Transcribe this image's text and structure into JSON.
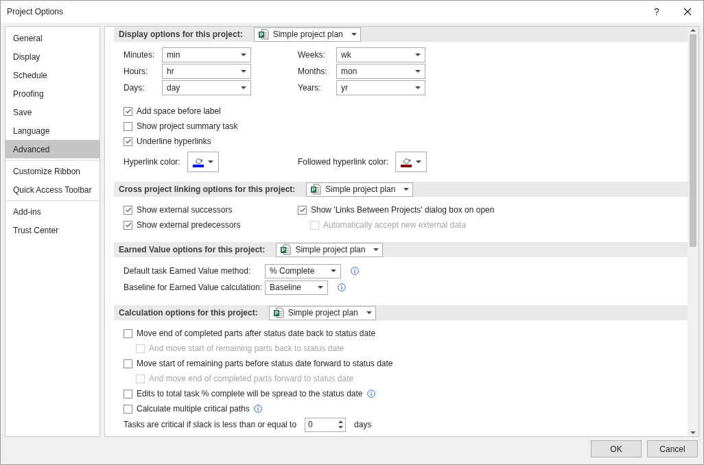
{
  "window": {
    "title": "Project Options",
    "help": "?"
  },
  "sidebar": {
    "groups": [
      [
        {
          "label": "General",
          "selected": false
        },
        {
          "label": "Display",
          "selected": false
        },
        {
          "label": "Schedule",
          "selected": false
        },
        {
          "label": "Proofing",
          "selected": false
        },
        {
          "label": "Save",
          "selected": false
        },
        {
          "label": "Language",
          "selected": false
        },
        {
          "label": "Advanced",
          "selected": true
        }
      ],
      [
        {
          "label": "Customize Ribbon",
          "selected": false
        },
        {
          "label": "Quick Access Toolbar",
          "selected": false
        }
      ],
      [
        {
          "label": "Add-ins",
          "selected": false
        },
        {
          "label": "Trust Center",
          "selected": false
        }
      ]
    ]
  },
  "sections": [
    {
      "title": "Display options for this project:",
      "plan": "Simple project plan",
      "items": [
        {
          "kind": "field_grid",
          "fields": [
            {
              "label": "Minutes:",
              "value": "min"
            },
            {
              "label": "Weeks:",
              "value": "wk"
            },
            {
              "label": "Hours:",
              "value": "hr"
            },
            {
              "label": "Months:",
              "value": "mon"
            },
            {
              "label": "Days:",
              "value": "day"
            },
            {
              "label": "Years:",
              "value": "yr"
            }
          ]
        },
        {
          "kind": "checkbox",
          "label": "Add space before label",
          "checked": true,
          "disabled": false,
          "info": false
        },
        {
          "kind": "checkbox",
          "label": "Show project summary task",
          "checked": false,
          "disabled": false,
          "info": false
        },
        {
          "kind": "checkbox",
          "label": "Underline hyperlinks",
          "checked": true,
          "disabled": false,
          "info": false
        },
        {
          "kind": "color_row",
          "pickers": [
            {
              "label": "Hyperlink color:",
              "color": "#0000ff"
            },
            {
              "label": "Followed hyperlink color:",
              "color": "#800000"
            }
          ]
        }
      ]
    },
    {
      "title": "Cross project linking options for this project:",
      "plan": "Simple project plan",
      "items": [
        {
          "kind": "columns",
          "columns": [
            [
              {
                "kind": "checkbox",
                "label": "Show external successors",
                "checked": true,
                "disabled": false,
                "info": false
              },
              {
                "kind": "checkbox",
                "label": "Show external predecessors",
                "checked": true,
                "disabled": false,
                "info": false
              }
            ],
            [
              {
                "kind": "checkbox",
                "label": "Show 'Links Between Projects' dialog box on open",
                "checked": true,
                "disabled": false,
                "info": false,
                "children": [
                  {
                    "kind": "checkbox",
                    "label": "Automatically accept new external data",
                    "checked": false,
                    "disabled": true,
                    "info": false
                  }
                ]
              }
            ]
          ]
        }
      ]
    },
    {
      "title": "Earned Value options for this project:",
      "plan": "Simple project plan",
      "items": [
        {
          "kind": "select",
          "label": "Default task Earned Value method:",
          "value": "% Complete",
          "info": true
        },
        {
          "kind": "select",
          "label": "Baseline for Earned Value calculation:",
          "value": "Baseline",
          "info": true
        }
      ]
    },
    {
      "title": "Calculation options for this project:",
      "plan": "Simple project plan",
      "items": [
        {
          "kind": "checkbox",
          "label": "Move end of completed parts after status date back to status date",
          "checked": false,
          "disabled": false,
          "info": false,
          "children": [
            {
              "kind": "checkbox",
              "label": "And move start of remaining parts back to status date",
              "checked": false,
              "disabled": true,
              "info": false
            }
          ]
        },
        {
          "kind": "checkbox",
          "label": "Move start of remaining parts before status date forward to status date",
          "checked": false,
          "disabled": false,
          "info": false,
          "children": [
            {
              "kind": "checkbox",
              "label": "And move end of completed parts forward to status date",
              "checked": false,
              "disabled": true,
              "info": false
            }
          ]
        },
        {
          "kind": "checkbox",
          "label": "Edits to total task % complete will be spread to the status date",
          "checked": false,
          "disabled": false,
          "info": true
        },
        {
          "kind": "checkbox",
          "label": "Calculate multiple critical paths",
          "checked": false,
          "disabled": false,
          "info": true
        },
        {
          "kind": "spinner",
          "label": "Tasks are critical if slack is less than or equal to",
          "value": "0",
          "unit": "days"
        }
      ]
    }
  ],
  "buttons": [
    "OK",
    "Cancel"
  ]
}
